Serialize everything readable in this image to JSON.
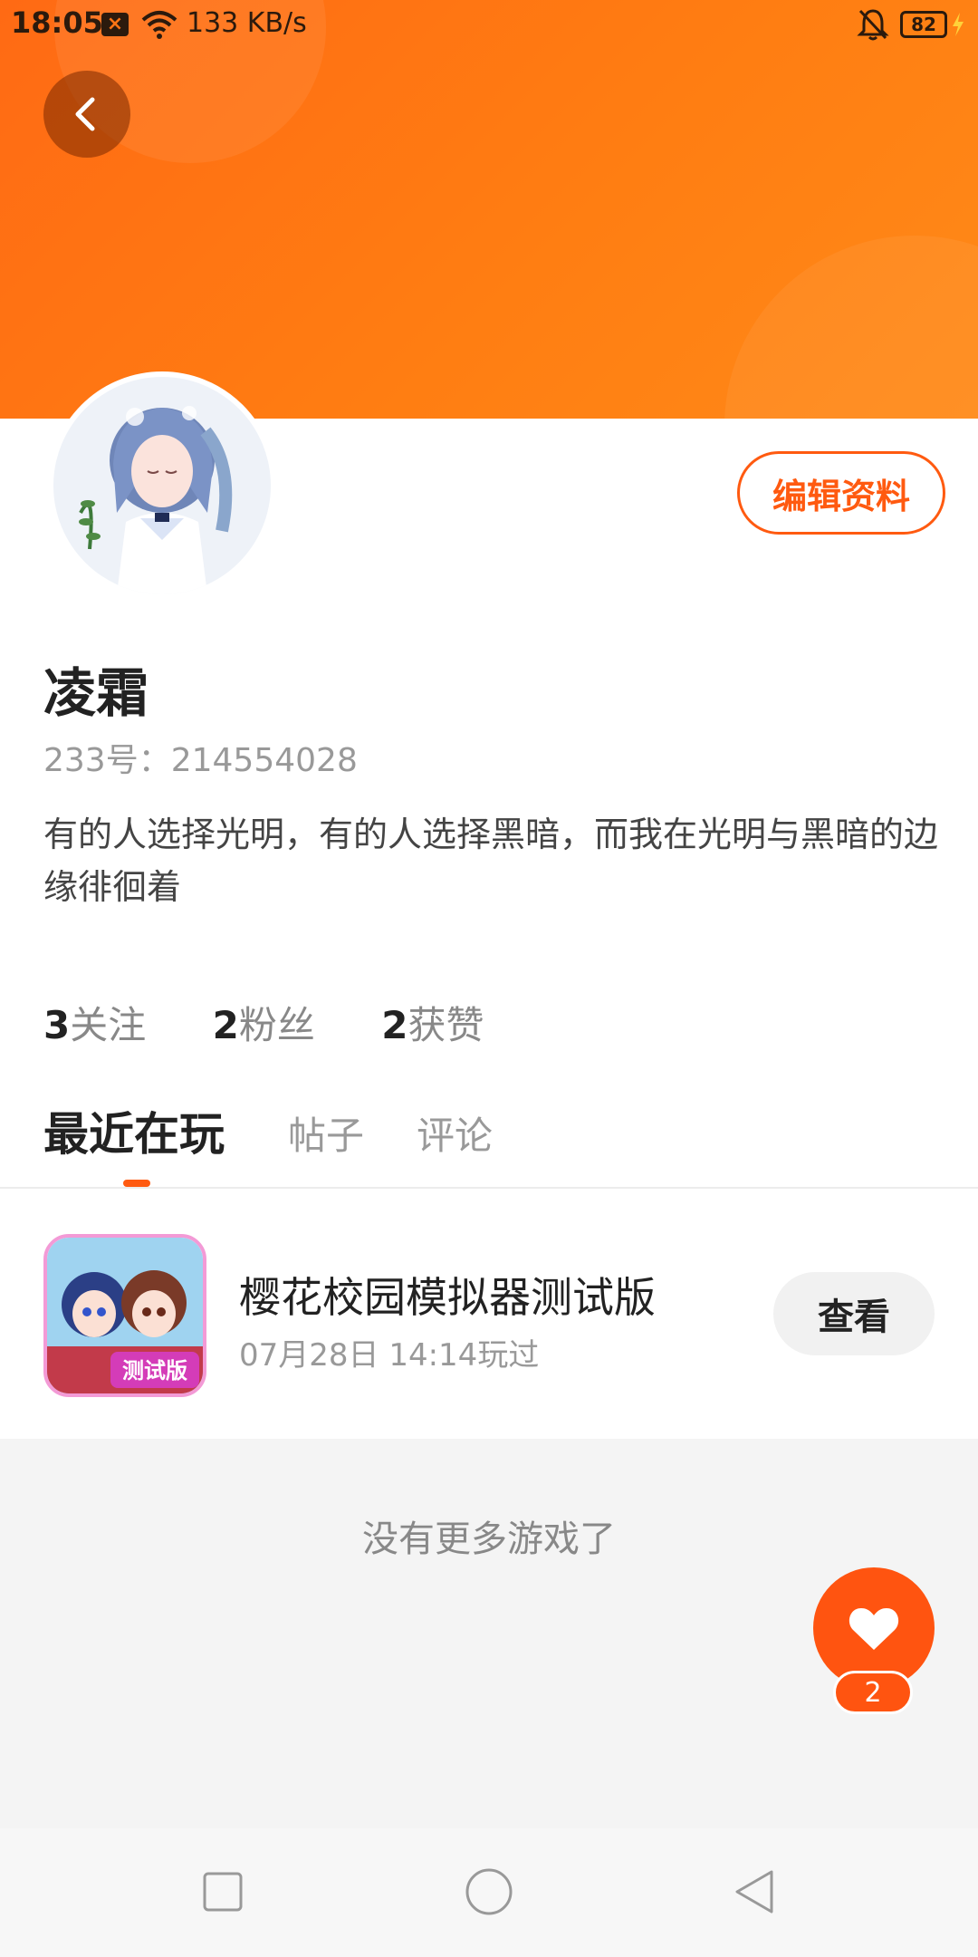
{
  "status_bar": {
    "time": "18:05",
    "network_speed": "133 KB/s",
    "battery": "82",
    "icons": [
      "notification-x-icon",
      "wifi-icon",
      "bell-muted-icon",
      "battery-icon",
      "charging-icon"
    ]
  },
  "header": {
    "back_icon": "chevron-left-icon",
    "accent_color": "#ff6a14"
  },
  "profile": {
    "name": "凌霜",
    "id_line": "233号：214554028",
    "bio": "有的人选择光明，有的人选择黑暗，而我在光明与黑暗的边缘徘徊着",
    "edit_button": "编辑资料",
    "stats": [
      {
        "count": "3",
        "label": "关注"
      },
      {
        "count": "2",
        "label": "粉丝"
      },
      {
        "count": "2",
        "label": "获赞"
      }
    ]
  },
  "tabs": [
    {
      "label": "最近在玩",
      "active": true
    },
    {
      "label": "帖子",
      "active": false
    },
    {
      "label": "评论",
      "active": false
    }
  ],
  "games": [
    {
      "title": "樱花校园模拟器测试版",
      "played": "07月28日 14:14玩过",
      "action": "查看",
      "icon_badge": "测试版"
    }
  ],
  "empty_message": "没有更多游戏了",
  "like_fab": {
    "icon": "heart-icon",
    "count": "2"
  },
  "nav_bar": {
    "icons": [
      "recent-apps-icon",
      "home-icon",
      "back-triangle-icon"
    ]
  }
}
